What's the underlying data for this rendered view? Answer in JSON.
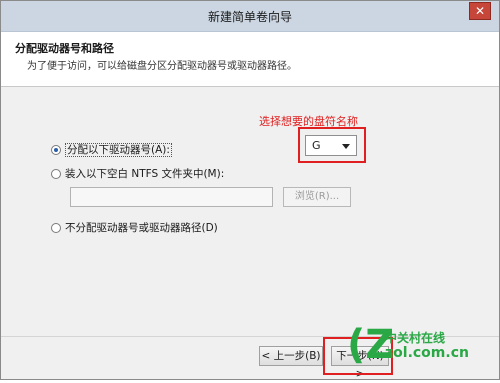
{
  "window": {
    "title": "新建简单卷向导",
    "close_glyph": "✕"
  },
  "header": {
    "title": "分配驱动器号和路径",
    "description": "为了便于访问，可以给磁盘分区分配驱动器号或驱动器路径。"
  },
  "annotation": {
    "text": "选择想要的盘符名称",
    "color": "#e02020"
  },
  "drive_select": {
    "value": "G"
  },
  "options": [
    {
      "label": "分配以下驱动器号(A):",
      "selected": true
    },
    {
      "label": "装入以下空白 NTFS 文件夹中(M):",
      "selected": false
    },
    {
      "label": "不分配驱动器号或驱动器路径(D)",
      "selected": false
    }
  ],
  "folder_path": {
    "value": ""
  },
  "browse_button": {
    "label": "浏览(R)..."
  },
  "buttons": {
    "back": "< 上一步(B)",
    "next": "下一步(N) >"
  },
  "watermark": {
    "brand": "中关村在线",
    "url": "zol.com.cn"
  }
}
